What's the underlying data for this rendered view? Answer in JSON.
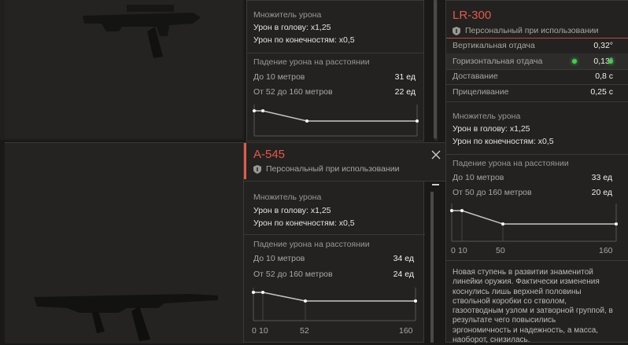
{
  "accent_color": "#e25a4c",
  "left_cards": {
    "top_weapon_icon": "famas-rifle-icon",
    "bottom_weapon_icon": "a545-rifle-icon"
  },
  "panel_top": {
    "multiplier_title": "Множитель урона",
    "head": "Урон в голову: x1,25",
    "limbs": "Урон по конечностям: x0,5",
    "falloff_title": "Падение урона на расстоянии",
    "rows": [
      {
        "label": "До 10 метров",
        "value": "31 ед"
      },
      {
        "label": "От 52 до 160 метров",
        "value": "22 ед"
      }
    ]
  },
  "panel_a545": {
    "title": "A-545",
    "subtitle": "Персональный при использовании",
    "multiplier_title": "Множитель урона",
    "head": "Урон в голову: x1,25",
    "limbs": "Урон по конечностям: x0,5",
    "falloff_title": "Падение урона на расстоянии",
    "rows": [
      {
        "label": "До 10 метров",
        "value": "34 ед"
      },
      {
        "label": "От 52 до 160 метров",
        "value": "24 ед"
      }
    ],
    "axis": [
      "0",
      "10",
      "52",
      "160"
    ]
  },
  "panel_lr300": {
    "title": "LR-300",
    "subtitle": "Персональный при использовании",
    "stats": [
      {
        "label": "Вертикальная отдача",
        "value": "0,32°"
      },
      {
        "label": "Горизонтальная отдача",
        "value": "0,13°"
      },
      {
        "label": "Доставание",
        "value": "0,8 с"
      },
      {
        "label": "Прицеливание",
        "value": "0,25 с"
      }
    ],
    "multiplier_title": "Множитель урона",
    "head": "Урон в голову: x1,25",
    "limbs": "Урон по конечностям: x0,5",
    "falloff_title": "Падение урона на расстоянии",
    "rows": [
      {
        "label": "До 10 метров",
        "value": "33 ед"
      },
      {
        "label": "От 50 до 160 метров",
        "value": "20 ед"
      }
    ],
    "axis": [
      "0",
      "10",
      "50",
      "160"
    ],
    "description": "Новая ступень в развитии знаменитой линейки оружия. Фактически изменения коснулись лишь верхней половины ствольной коробки со стволом, газоотводным узлом и затворной группой, в результате чего повысились эргономичность и надежность, а масса, наоборот, снизилась."
  }
}
